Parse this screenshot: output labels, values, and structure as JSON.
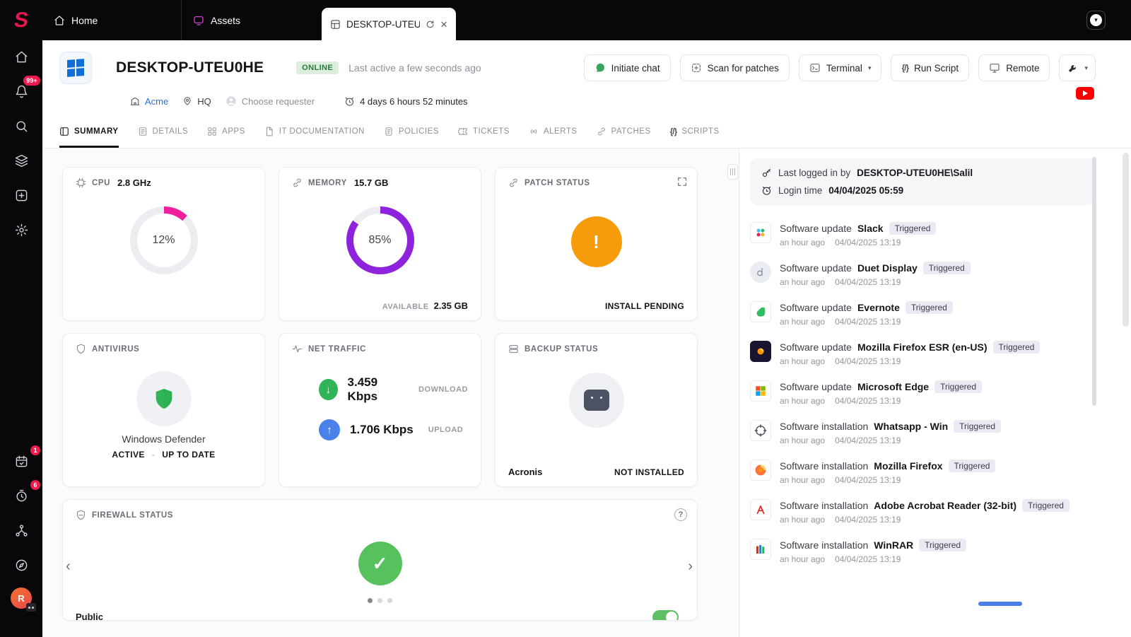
{
  "icons": {
    "logo": "S",
    "close_tab": "×",
    "caret_down": "▾",
    "code": "{/}",
    "exclamation": "!",
    "check": "✓",
    "question": "?",
    "arrow_down": "↓",
    "arrow_up": "↑",
    "chevron_left": "‹",
    "chevron_right": "›"
  },
  "colors": {
    "brand": "#e8174f",
    "online_green": "#2c7a3f",
    "warning_orange": "#f59b0c",
    "success_green": "#57c15d",
    "download_green": "#2fb457",
    "upload_blue": "#4b81ea"
  },
  "topbar": {
    "home": "Home",
    "assets": "Assets",
    "tab": "DESKTOP-UTEU..."
  },
  "sidebar": {
    "notifications_badge": "99+",
    "tasks_badge": "1",
    "timers_badge": "6",
    "avatar": "R"
  },
  "header": {
    "title": "DESKTOP-UTEU0HE",
    "status": "ONLINE",
    "last_active": "Last active a few seconds ago",
    "client": "Acme",
    "site": "HQ",
    "requester": "Choose requester",
    "uptime": "4 days 6 hours 52 minutes",
    "chat": "Initiate chat",
    "scan": "Scan for patches",
    "terminal": "Terminal",
    "run_script": "Run Script",
    "remote": "Remote"
  },
  "tabs": {
    "summary": "SUMMARY",
    "details": "DETAILS",
    "apps": "APPS",
    "it_documentation": "IT DOCUMENTATION",
    "policies": "POLICIES",
    "tickets": "TICKETS",
    "alerts": "ALERTS",
    "patches": "PATCHES",
    "scripts": "SCRIPTS"
  },
  "cards": {
    "cpu": {
      "label": "CPU",
      "value": "2.8 GHz",
      "percent": 12,
      "percent_label": "12%",
      "color": "#ef1f9e"
    },
    "memory": {
      "label": "MEMORY",
      "value": "15.7 GB",
      "percent": 85,
      "percent_label": "85%",
      "available_label": "AVAILABLE",
      "available_value": "2.35 GB",
      "color": "#8f22dd"
    },
    "patch": {
      "label": "PATCH STATUS",
      "status": "INSTALL PENDING"
    },
    "antivirus": {
      "label": "ANTIVIRUS",
      "product": "Windows Defender",
      "state": "ACTIVE",
      "separator": "-",
      "freshness": "UP TO DATE"
    },
    "net": {
      "label": "NET TRAFFIC",
      "down_value": "3.459 Kbps",
      "down_label": "DOWNLOAD",
      "up_value": "1.706 Kbps",
      "up_label": "UPLOAD"
    },
    "backup": {
      "label": "BACKUP STATUS",
      "product": "Acronis",
      "status": "NOT INSTALLED"
    },
    "firewall": {
      "label": "FIREWALL STATUS",
      "profile": "Public",
      "toggle_on": true
    }
  },
  "activity": {
    "login_label": "Last logged in by",
    "login_user": "DESKTOP-UTEU0HE\\Salil",
    "login_time_label": "Login time",
    "login_time": "04/04/2025 05:59",
    "items": [
      {
        "action": "Software update",
        "name": "Slack",
        "badge": "Triggered",
        "ago": "an hour ago",
        "time": "04/04/2025 13:19"
      },
      {
        "action": "Software update",
        "name": "Duet Display",
        "badge": "Triggered",
        "ago": "an hour ago",
        "time": "04/04/2025 13:19"
      },
      {
        "action": "Software update",
        "name": "Evernote",
        "badge": "Triggered",
        "ago": "an hour ago",
        "time": "04/04/2025 13:19"
      },
      {
        "action": "Software update",
        "name": "Mozilla Firefox ESR (en-US)",
        "badge": "Triggered",
        "ago": "an hour ago",
        "time": "04/04/2025 13:19"
      },
      {
        "action": "Software update",
        "name": "Microsoft Edge",
        "badge": "Triggered",
        "ago": "an hour ago",
        "time": "04/04/2025 13:19"
      },
      {
        "action": "Software installation",
        "name": "Whatsapp - Win",
        "badge": "Triggered",
        "ago": "an hour ago",
        "time": "04/04/2025 13:19"
      },
      {
        "action": "Software installation",
        "name": "Mozilla Firefox",
        "badge": "Triggered",
        "ago": "an hour ago",
        "time": "04/04/2025 13:19"
      },
      {
        "action": "Software installation",
        "name": "Adobe Acrobat Reader (32-bit)",
        "badge": "Triggered",
        "ago": "an hour ago",
        "time": "04/04/2025 13:19"
      },
      {
        "action": "Software installation",
        "name": "WinRAR",
        "badge": "Triggered",
        "ago": "an hour ago",
        "time": "04/04/2025 13:19"
      }
    ]
  }
}
